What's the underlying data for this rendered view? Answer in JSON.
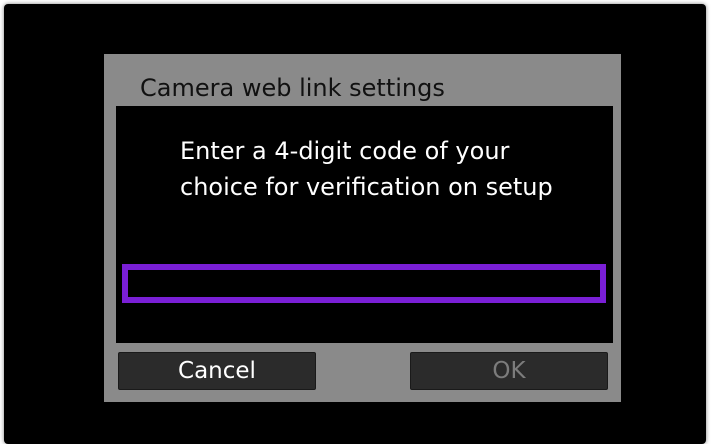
{
  "dialog": {
    "title": "Camera web link settings",
    "message_lines": [
      "Enter a 4-digit code of your",
      "choice for verification on setup"
    ],
    "code_input": {
      "value": "",
      "placeholder": ""
    },
    "buttons": {
      "cancel_label": "Cancel",
      "ok_label": "OK"
    }
  },
  "colors": {
    "screen_background": "#000000",
    "dialog_frame": "#8a8a8a",
    "input_focus_border": "#7a1fd6",
    "button_background": "#2b2b2b",
    "disabled_text": "#7c7c7c"
  }
}
